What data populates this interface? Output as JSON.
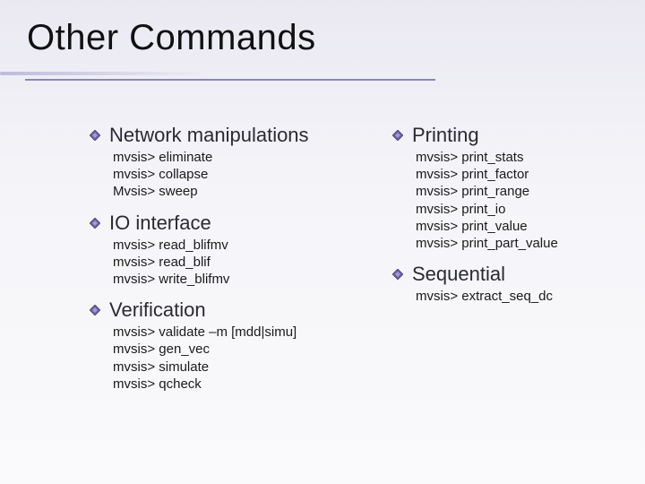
{
  "title": "Other Commands",
  "left": [
    {
      "heading": "Network manipulations",
      "commands": [
        "mvsis> eliminate",
        "mvsis> collapse",
        "Mvsis> sweep"
      ]
    },
    {
      "heading": "IO interface",
      "commands": [
        "mvsis> read_blifmv",
        "mvsis> read_blif",
        "mvsis> write_blifmv"
      ]
    },
    {
      "heading": "Verification",
      "commands": [
        "mvsis> validate –m [mdd|simu]",
        "mvsis> gen_vec",
        "mvsis> simulate",
        "mvsis> qcheck"
      ]
    }
  ],
  "right": [
    {
      "heading": "Printing",
      "commands": [
        "mvsis> print_stats",
        "mvsis> print_factor",
        "mvsis> print_range",
        "mvsis> print_io",
        "mvsis> print_value",
        "mvsis> print_part_value"
      ]
    },
    {
      "heading": "Sequential",
      "commands": [
        "mvsis> extract_seq_dc"
      ]
    }
  ]
}
